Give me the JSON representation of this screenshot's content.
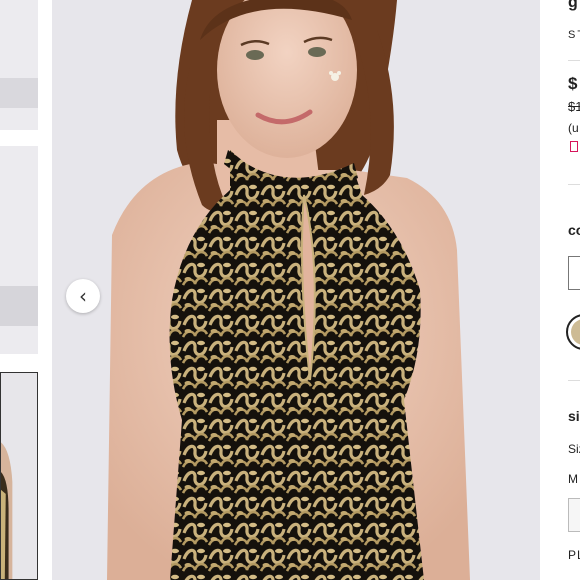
{
  "gallery": {
    "prev_icon": "‹",
    "thumbnails": [
      "thumbnail-1",
      "thumbnail-2",
      "thumbnail-3"
    ]
  },
  "product": {
    "title": "g",
    "style_number": "ST",
    "price": "$",
    "original_price": "$1",
    "note": "(u",
    "color_label": "co",
    "size_label": "si",
    "size_guide": "Siz",
    "size_selected": "M",
    "plus_label": "PL"
  },
  "colors": {
    "accent": "#d6155b",
    "swatch": "#cdbb95"
  }
}
